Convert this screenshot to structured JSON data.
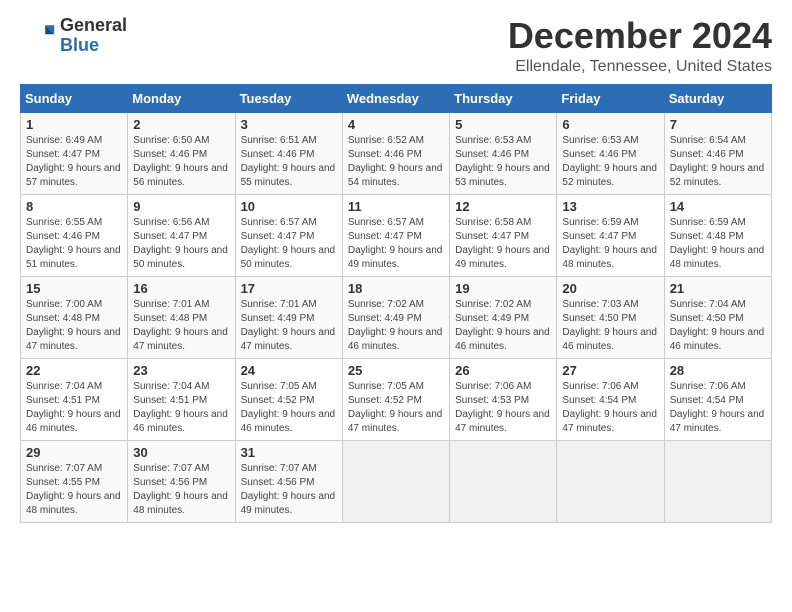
{
  "logo": {
    "general": "General",
    "blue": "Blue"
  },
  "title": "December 2024",
  "subtitle": "Ellendale, Tennessee, United States",
  "headers": [
    "Sunday",
    "Monday",
    "Tuesday",
    "Wednesday",
    "Thursday",
    "Friday",
    "Saturday"
  ],
  "weeks": [
    [
      {
        "num": "1",
        "sunrise": "6:49 AM",
        "sunset": "4:47 PM",
        "daylight": "9 hours and 57 minutes."
      },
      {
        "num": "2",
        "sunrise": "6:50 AM",
        "sunset": "4:46 PM",
        "daylight": "9 hours and 56 minutes."
      },
      {
        "num": "3",
        "sunrise": "6:51 AM",
        "sunset": "4:46 PM",
        "daylight": "9 hours and 55 minutes."
      },
      {
        "num": "4",
        "sunrise": "6:52 AM",
        "sunset": "4:46 PM",
        "daylight": "9 hours and 54 minutes."
      },
      {
        "num": "5",
        "sunrise": "6:53 AM",
        "sunset": "4:46 PM",
        "daylight": "9 hours and 53 minutes."
      },
      {
        "num": "6",
        "sunrise": "6:53 AM",
        "sunset": "4:46 PM",
        "daylight": "9 hours and 52 minutes."
      },
      {
        "num": "7",
        "sunrise": "6:54 AM",
        "sunset": "4:46 PM",
        "daylight": "9 hours and 52 minutes."
      }
    ],
    [
      {
        "num": "8",
        "sunrise": "6:55 AM",
        "sunset": "4:46 PM",
        "daylight": "9 hours and 51 minutes."
      },
      {
        "num": "9",
        "sunrise": "6:56 AM",
        "sunset": "4:47 PM",
        "daylight": "9 hours and 50 minutes."
      },
      {
        "num": "10",
        "sunrise": "6:57 AM",
        "sunset": "4:47 PM",
        "daylight": "9 hours and 50 minutes."
      },
      {
        "num": "11",
        "sunrise": "6:57 AM",
        "sunset": "4:47 PM",
        "daylight": "9 hours and 49 minutes."
      },
      {
        "num": "12",
        "sunrise": "6:58 AM",
        "sunset": "4:47 PM",
        "daylight": "9 hours and 49 minutes."
      },
      {
        "num": "13",
        "sunrise": "6:59 AM",
        "sunset": "4:47 PM",
        "daylight": "9 hours and 48 minutes."
      },
      {
        "num": "14",
        "sunrise": "6:59 AM",
        "sunset": "4:48 PM",
        "daylight": "9 hours and 48 minutes."
      }
    ],
    [
      {
        "num": "15",
        "sunrise": "7:00 AM",
        "sunset": "4:48 PM",
        "daylight": "9 hours and 47 minutes."
      },
      {
        "num": "16",
        "sunrise": "7:01 AM",
        "sunset": "4:48 PM",
        "daylight": "9 hours and 47 minutes."
      },
      {
        "num": "17",
        "sunrise": "7:01 AM",
        "sunset": "4:49 PM",
        "daylight": "9 hours and 47 minutes."
      },
      {
        "num": "18",
        "sunrise": "7:02 AM",
        "sunset": "4:49 PM",
        "daylight": "9 hours and 46 minutes."
      },
      {
        "num": "19",
        "sunrise": "7:02 AM",
        "sunset": "4:49 PM",
        "daylight": "9 hours and 46 minutes."
      },
      {
        "num": "20",
        "sunrise": "7:03 AM",
        "sunset": "4:50 PM",
        "daylight": "9 hours and 46 minutes."
      },
      {
        "num": "21",
        "sunrise": "7:04 AM",
        "sunset": "4:50 PM",
        "daylight": "9 hours and 46 minutes."
      }
    ],
    [
      {
        "num": "22",
        "sunrise": "7:04 AM",
        "sunset": "4:51 PM",
        "daylight": "9 hours and 46 minutes."
      },
      {
        "num": "23",
        "sunrise": "7:04 AM",
        "sunset": "4:51 PM",
        "daylight": "9 hours and 46 minutes."
      },
      {
        "num": "24",
        "sunrise": "7:05 AM",
        "sunset": "4:52 PM",
        "daylight": "9 hours and 46 minutes."
      },
      {
        "num": "25",
        "sunrise": "7:05 AM",
        "sunset": "4:52 PM",
        "daylight": "9 hours and 47 minutes."
      },
      {
        "num": "26",
        "sunrise": "7:06 AM",
        "sunset": "4:53 PM",
        "daylight": "9 hours and 47 minutes."
      },
      {
        "num": "27",
        "sunrise": "7:06 AM",
        "sunset": "4:54 PM",
        "daylight": "9 hours and 47 minutes."
      },
      {
        "num": "28",
        "sunrise": "7:06 AM",
        "sunset": "4:54 PM",
        "daylight": "9 hours and 47 minutes."
      }
    ],
    [
      {
        "num": "29",
        "sunrise": "7:07 AM",
        "sunset": "4:55 PM",
        "daylight": "9 hours and 48 minutes."
      },
      {
        "num": "30",
        "sunrise": "7:07 AM",
        "sunset": "4:56 PM",
        "daylight": "9 hours and 48 minutes."
      },
      {
        "num": "31",
        "sunrise": "7:07 AM",
        "sunset": "4:56 PM",
        "daylight": "9 hours and 49 minutes."
      },
      null,
      null,
      null,
      null
    ]
  ]
}
